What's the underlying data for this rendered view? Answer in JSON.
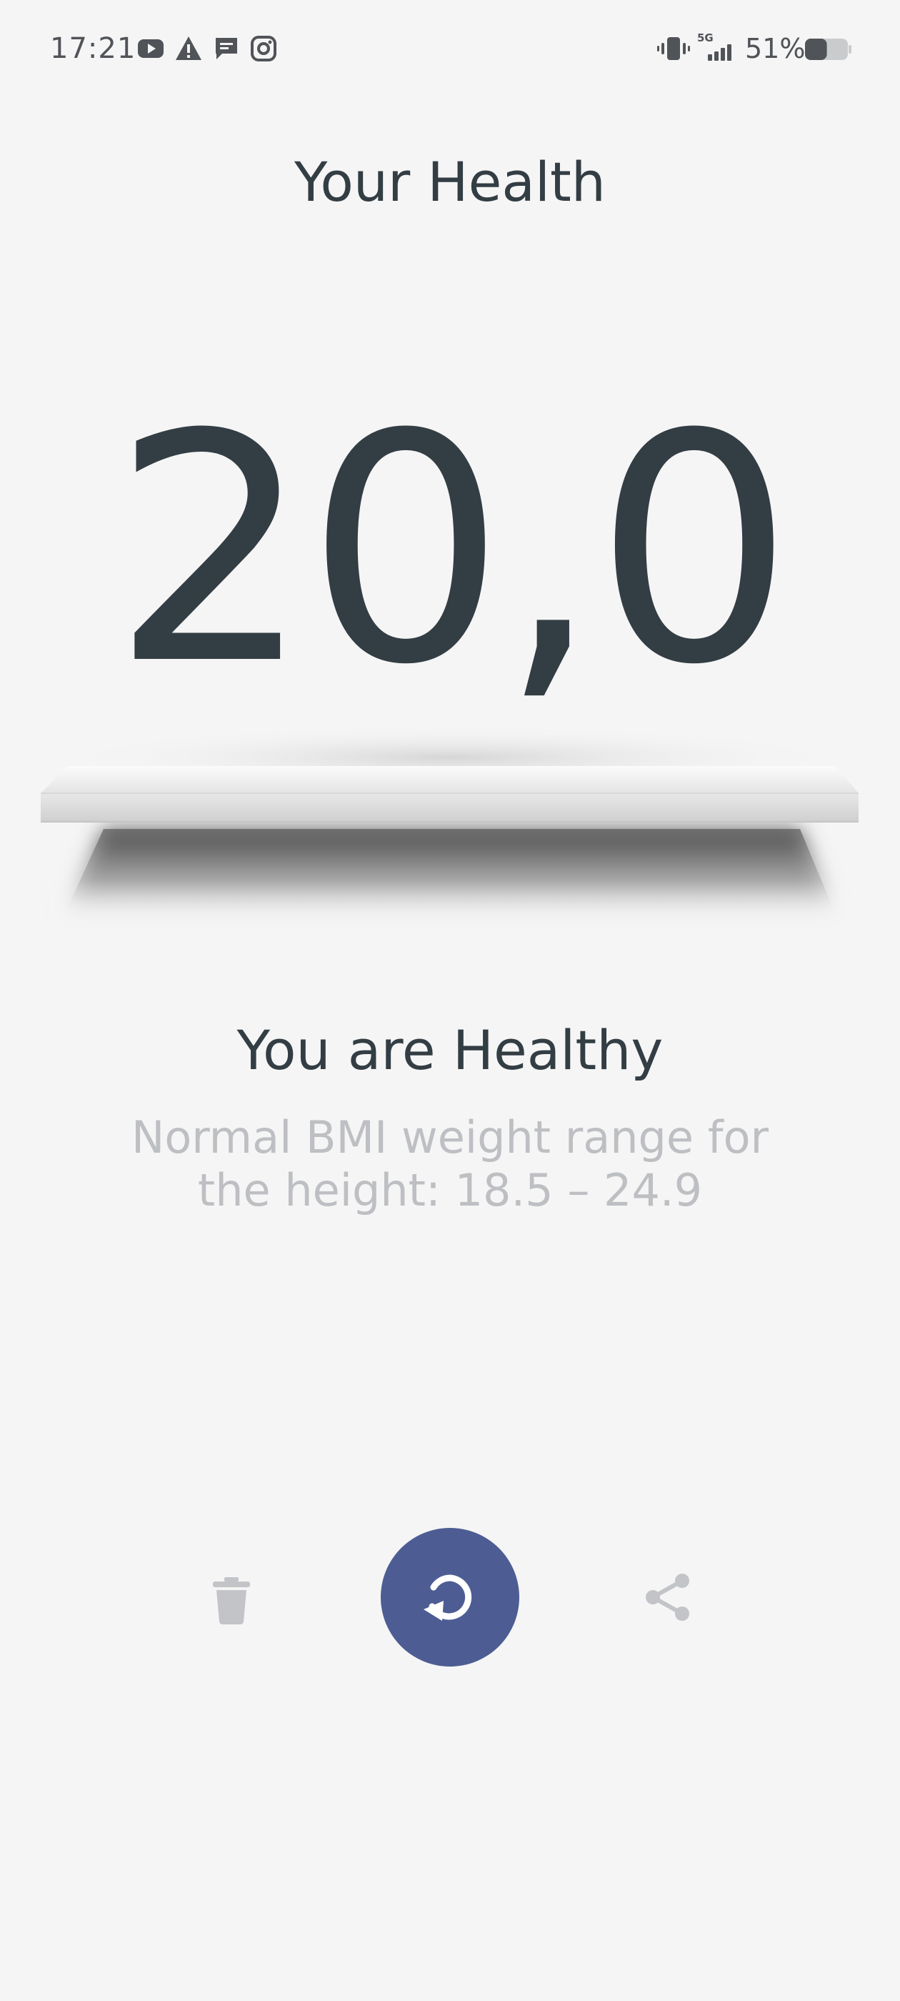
{
  "status_bar": {
    "time": "17:21",
    "notification_icons": [
      "youtube-icon",
      "warning-icon",
      "message-icon",
      "instagram-icon"
    ],
    "network": "5G",
    "battery_percent": "51%",
    "battery_level": 0.51
  },
  "header": {
    "title": "Your Health"
  },
  "result": {
    "bmi_value": "20,0",
    "label": "You are Healthy",
    "description": "Normal BMI weight range for the height: 18.5 – 24.9"
  },
  "actions": {
    "delete_icon": "trash-icon",
    "refresh_icon": "refresh-icon",
    "share_icon": "share-icon"
  },
  "colors": {
    "background": "#f5f5f5",
    "primary_text": "#333d44",
    "secondary_text": "#bdbfc2",
    "accent": "#4d5d93",
    "icon_muted": "#c2c4c7"
  }
}
